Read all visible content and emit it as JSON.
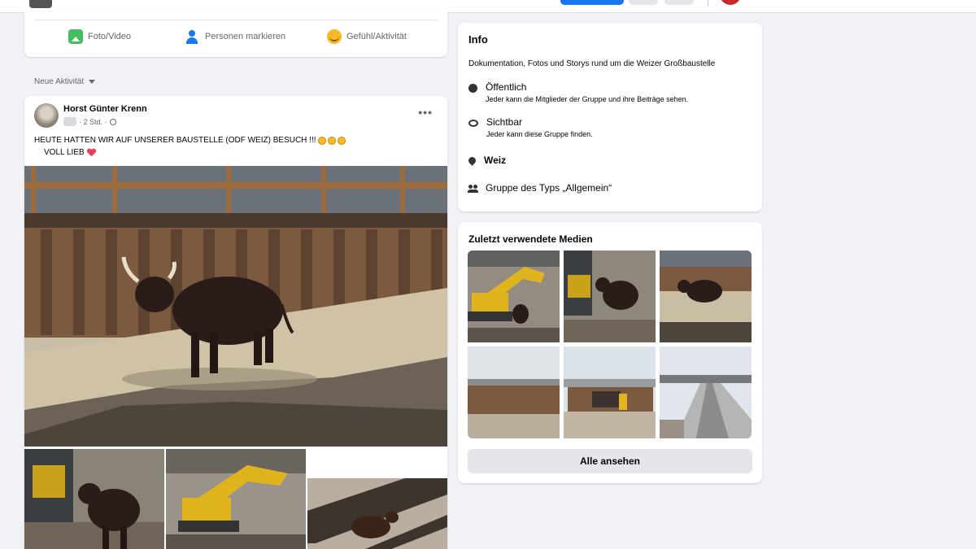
{
  "composer": {
    "photo_label": "Foto/Video",
    "tag_label": "Personen markieren",
    "feeling_label": "Gefühl/Aktivität"
  },
  "feed": {
    "sort_label": "Neue Aktivität"
  },
  "post": {
    "author": "Horst Günter Krenn",
    "time": "· 2 Std. ·",
    "text_line1": "HEUTE HATTEN WIR AUF UNSERER BAUSTELLE (ODF WEIZ) BESUCH !!!",
    "text_line2": "VOLL LIEB",
    "more_label": "•••"
  },
  "info": {
    "title": "Info",
    "description": "Dokumentation, Fotos und Storys rund um die Weizer Großbaustelle",
    "privacy_title": "Öffentlich",
    "privacy_sub": "Jeder kann die Mitglieder der Gruppe und ihre Beiträge sehen.",
    "visibility_title": "Sichtbar",
    "visibility_sub": "Jeder kann diese Gruppe finden.",
    "location": "Weiz",
    "group_type": "Gruppe des Typs „Allgemein“"
  },
  "media": {
    "title": "Zuletzt verwendete Medien",
    "see_all_label": "Alle ansehen"
  },
  "colors": {
    "brand_blue": "#1877f2",
    "page_bg": "#f0f2f5",
    "card_bg": "#ffffff"
  }
}
